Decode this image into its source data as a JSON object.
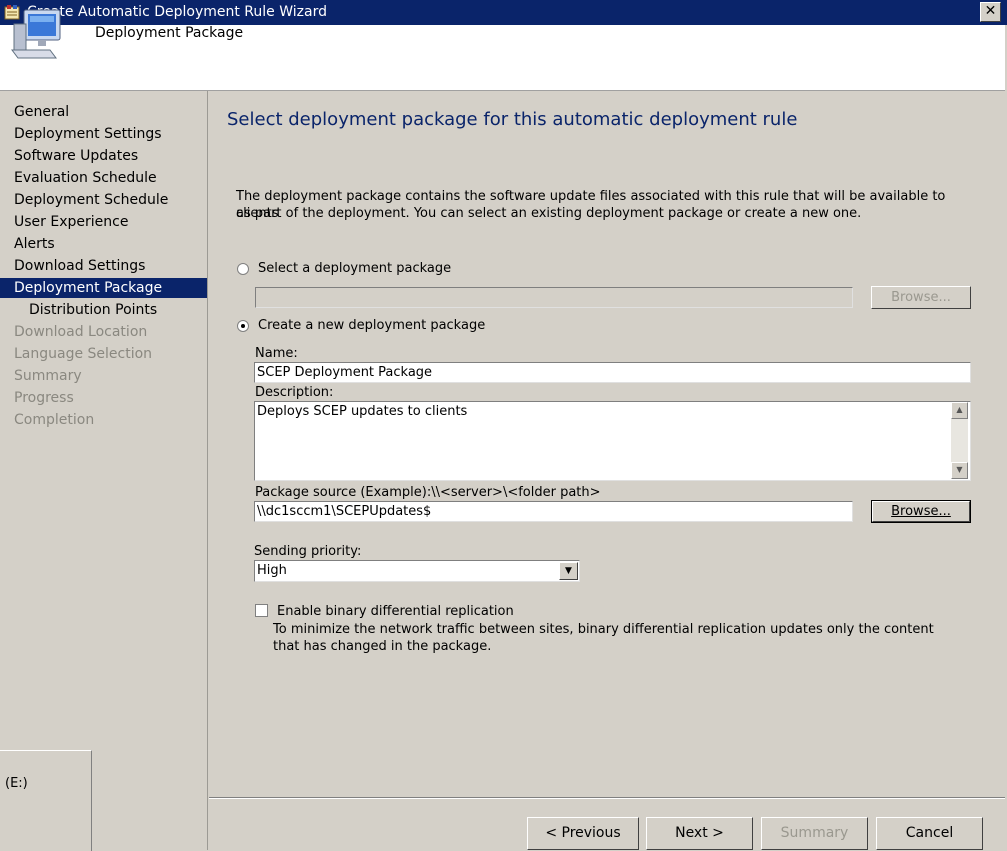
{
  "window": {
    "title": "Create Automatic Deployment Rule Wizard",
    "close_label": "✕"
  },
  "header": {
    "title": "Deployment Package",
    "icon": "computer-icon"
  },
  "sidebar": {
    "items": [
      {
        "label": "General",
        "state": "normal"
      },
      {
        "label": "Deployment Settings",
        "state": "normal"
      },
      {
        "label": "Software Updates",
        "state": "normal"
      },
      {
        "label": "Evaluation Schedule",
        "state": "normal"
      },
      {
        "label": "Deployment Schedule",
        "state": "normal"
      },
      {
        "label": "User Experience",
        "state": "normal"
      },
      {
        "label": "Alerts",
        "state": "normal"
      },
      {
        "label": "Download Settings",
        "state": "normal"
      },
      {
        "label": "Deployment Package",
        "state": "selected"
      },
      {
        "label": "Distribution Points",
        "state": "sub"
      },
      {
        "label": "Download Location",
        "state": "disabled"
      },
      {
        "label": "Language Selection",
        "state": "disabled"
      },
      {
        "label": "Summary",
        "state": "disabled"
      },
      {
        "label": "Progress",
        "state": "disabled"
      },
      {
        "label": "Completion",
        "state": "disabled"
      }
    ],
    "drive_label": "(E:)"
  },
  "main": {
    "heading": "Select deployment package for this automatic deployment rule",
    "description_line1": "The deployment package contains the software update files associated with this rule that will be available to clients",
    "description_line2": "as part of the deployment. You can select an existing deployment package or create a new one.",
    "select_existing": {
      "label": "Select a deployment package",
      "value": "",
      "browse_label": "Browse...",
      "selected": false
    },
    "create_new": {
      "label": "Create a new deployment package",
      "selected": true
    },
    "name": {
      "label": "Name:",
      "value": "SCEP Deployment Package"
    },
    "description": {
      "label": "Description:",
      "value": "Deploys SCEP updates to clients"
    },
    "package_source": {
      "label": "Package source (Example):\\\\<server>\\<folder path>",
      "value": "\\\\dc1sccm1\\SCEPUpdates$",
      "browse_label": "Browse..."
    },
    "sending_priority": {
      "label": "Sending priority:",
      "value": "High"
    },
    "binary_replication": {
      "label": "Enable binary differential replication",
      "checked": false,
      "help_line1": "To minimize the network traffic between sites, binary differential replication updates only the content",
      "help_line2": "that has changed in the package."
    }
  },
  "footer": {
    "previous": "< Previous",
    "next": "Next >",
    "summary": "Summary",
    "cancel": "Cancel"
  }
}
